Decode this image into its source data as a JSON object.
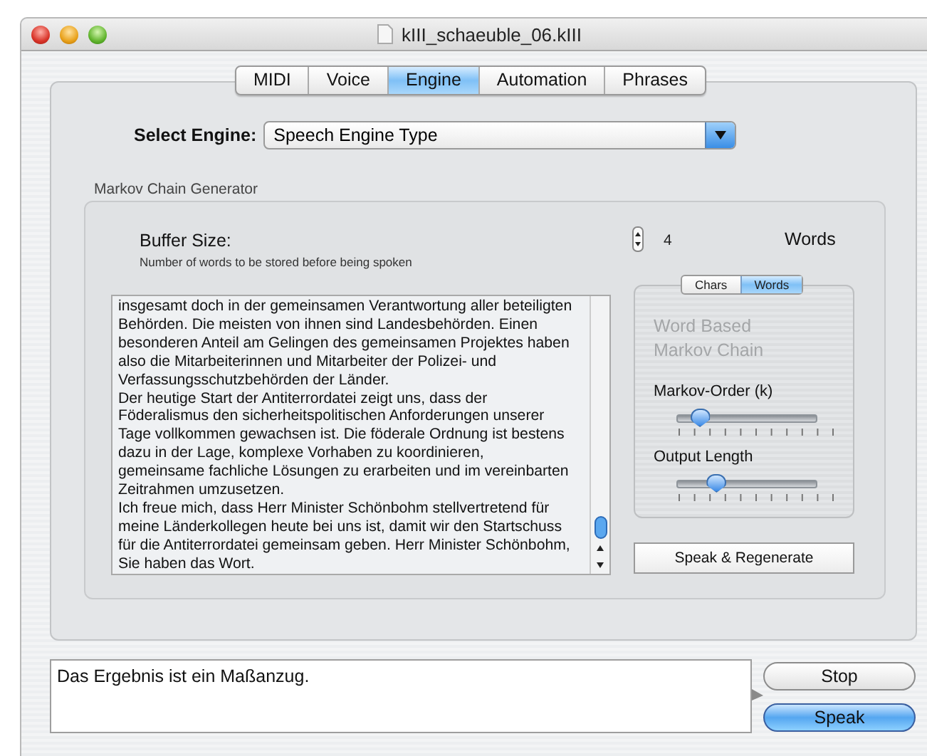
{
  "window": {
    "title": "kIII_schaeuble_06.kIII"
  },
  "tabs": [
    {
      "label": "MIDI",
      "selected": false
    },
    {
      "label": "Voice",
      "selected": false
    },
    {
      "label": "Engine",
      "selected": true
    },
    {
      "label": "Automation",
      "selected": false
    },
    {
      "label": "Phrases",
      "selected": false
    }
  ],
  "engine": {
    "label": "Select Engine:",
    "value": "Speech Engine Type"
  },
  "markov_group": {
    "title": "Markov Chain Generator",
    "buffer": {
      "label": "Buffer Size:",
      "hint": "Number of words to be stored before being spoken",
      "value": "4",
      "unit": "Words"
    },
    "text_lines": [
      "insgesamt doch in der gemeinsamen Verantwortung aller beteiligten",
      "Behörden. Die meisten von ihnen sind Landesbehörden. Einen",
      "besonderen Anteil am Gelingen des gemeinsamen Projektes haben",
      "also die Mitarbeiterinnen und Mitarbeiter der Polizei- und",
      "Verfassungsschutzbehörden der Länder.",
      "Der heutige Start der Antiterrordatei zeigt uns, dass der",
      "Föderalismus den sicherheitspolitischen Anforderungen unserer",
      "Tage vollkommen gewachsen ist. Die föderale Ordnung ist bestens",
      "dazu in der Lage, komplexe Vorhaben zu koordinieren,",
      "gemeinsame fachliche Lösungen zu erarbeiten und im vereinbarten",
      "Zeitrahmen umzusetzen.",
      "Ich freue mich, dass Herr Minister Schönbohm stellvertretend für",
      "meine Länderkollegen heute bei uns ist, damit wir den Startschuss",
      "für die Antiterrordatei gemeinsam geben. Herr Minister Schönbohm,",
      "Sie haben das Wort."
    ],
    "mode": [
      {
        "label": "Chars",
        "selected": false
      },
      {
        "label": "Words",
        "selected": true
      }
    ],
    "caption_lines": [
      "Word Based",
      "Markov Chain"
    ],
    "sliders": [
      {
        "label": "Markov-Order (k)",
        "level": 0.15
      },
      {
        "label": "Output Length",
        "level": 0.27
      }
    ],
    "regenerate_button": "Speak & Regenerate"
  },
  "output": {
    "value": "Das Ergebnis ist ein Maßanzug."
  },
  "buttons": [
    {
      "label": "Stop",
      "default": false
    },
    {
      "label": "Speak",
      "default": true
    }
  ]
}
